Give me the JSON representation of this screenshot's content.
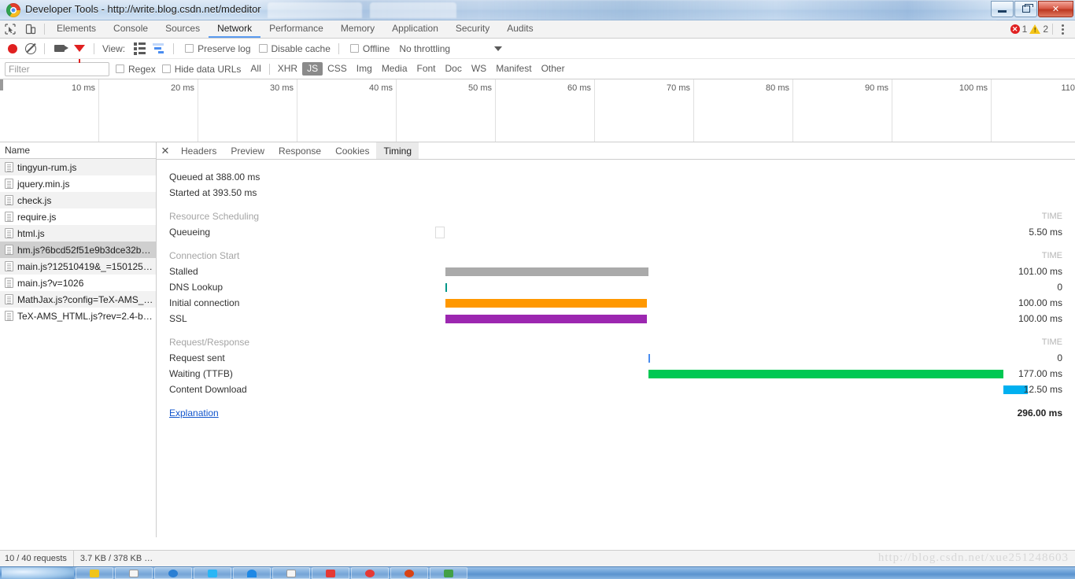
{
  "window": {
    "title": "Developer Tools - http://write.blog.csdn.net/mdeditor",
    "controls": {
      "minimize": "minimize",
      "maximize": "maximize",
      "close": "✕"
    }
  },
  "maintabs": {
    "inspect_icon": "inspect-element-icon",
    "device_icon": "device-toolbar-icon",
    "items": [
      {
        "label": "Elements",
        "active": false
      },
      {
        "label": "Console",
        "active": false
      },
      {
        "label": "Sources",
        "active": false
      },
      {
        "label": "Network",
        "active": true
      },
      {
        "label": "Performance",
        "active": false
      },
      {
        "label": "Memory",
        "active": false
      },
      {
        "label": "Application",
        "active": false
      },
      {
        "label": "Security",
        "active": false
      },
      {
        "label": "Audits",
        "active": false
      }
    ],
    "error_count": "1",
    "warning_count": "2",
    "menu_icon": "kebab-menu-icon"
  },
  "toolbar": {
    "record_icon": "record-icon",
    "clear_icon": "clear-icon",
    "camera_icon": "screenshot-camera-icon",
    "filter_icon": "filter-funnel-icon",
    "view_label": "View:",
    "view_list_icon": "list-view-icon",
    "view_waterfall_icon": "waterfall-view-icon",
    "preserve_log": "Preserve log",
    "disable_cache": "Disable cache",
    "offline": "Offline",
    "throttling": "No throttling"
  },
  "filterbar": {
    "filter_placeholder": "Filter",
    "filter_value": "",
    "regex": "Regex",
    "hide_data_urls": "Hide data URLs",
    "types": [
      {
        "label": "All",
        "active": false
      },
      {
        "label": "XHR",
        "active": false
      },
      {
        "label": "JS",
        "active": true
      },
      {
        "label": "CSS",
        "active": false
      },
      {
        "label": "Img",
        "active": false
      },
      {
        "label": "Media",
        "active": false
      },
      {
        "label": "Font",
        "active": false
      },
      {
        "label": "Doc",
        "active": false
      },
      {
        "label": "WS",
        "active": false
      },
      {
        "label": "Manifest",
        "active": false
      },
      {
        "label": "Other",
        "active": false
      }
    ]
  },
  "timeline_ruler": {
    "ticks": [
      "10 ms",
      "20 ms",
      "30 ms",
      "40 ms",
      "50 ms",
      "60 ms",
      "70 ms",
      "80 ms",
      "90 ms",
      "100 ms",
      "110"
    ]
  },
  "requests": {
    "header": "Name",
    "rows": [
      {
        "name": "tingyun-rum.js",
        "selected": false
      },
      {
        "name": "jquery.min.js",
        "selected": false
      },
      {
        "name": "check.js",
        "selected": false
      },
      {
        "name": "require.js",
        "selected": false
      },
      {
        "name": "html.js",
        "selected": false
      },
      {
        "name": "hm.js?6bcd52f51e9b3dce32be…",
        "selected": true
      },
      {
        "name": "main.js?12510419&_=1501250…",
        "selected": false
      },
      {
        "name": "main.js?v=1026",
        "selected": false
      },
      {
        "name": "MathJax.js?config=TeX-AMS_…",
        "selected": false
      },
      {
        "name": "TeX-AMS_HTML.js?rev=2.4-be…",
        "selected": false
      }
    ]
  },
  "detail": {
    "close_icon": "close-icon",
    "tabs": [
      {
        "label": "Headers",
        "active": false
      },
      {
        "label": "Preview",
        "active": false
      },
      {
        "label": "Response",
        "active": false
      },
      {
        "label": "Cookies",
        "active": false
      },
      {
        "label": "Timing",
        "active": true
      }
    ],
    "queued_at": "Queued at 388.00 ms",
    "started_at": "Started at 393.50 ms",
    "time_header": "TIME",
    "explanation_link": "Explanation",
    "total_time": "296.00 ms",
    "sections": [
      {
        "title": "Resource Scheduling",
        "rows": [
          {
            "label": "Queueing",
            "time": "5.50 ms",
            "bar": "queue",
            "left_pct": 0.0,
            "width_pct": 1.5
          }
        ]
      },
      {
        "title": "Connection Start",
        "rows": [
          {
            "label": "Stalled",
            "time": "101.00 ms",
            "bar": "stalled",
            "left_pct": 1.8,
            "width_pct": 34.1
          },
          {
            "label": "DNS Lookup",
            "time": "0",
            "bar": "dns",
            "left_pct": 1.8,
            "width_pct": 0.25
          },
          {
            "label": "Initial connection",
            "time": "100.00 ms",
            "bar": "conn",
            "left_pct": 1.8,
            "width_pct": 33.8
          },
          {
            "label": "SSL",
            "time": "100.00 ms",
            "bar": "ssl",
            "left_pct": 1.8,
            "width_pct": 33.8
          }
        ]
      },
      {
        "title": "Request/Response",
        "rows": [
          {
            "label": "Request sent",
            "time": "0",
            "bar": "reqsent",
            "left_pct": 35.9,
            "width_pct": 0.25
          },
          {
            "label": "Waiting (TTFB)",
            "time": "177.00 ms",
            "bar": "ttfb",
            "left_pct": 35.9,
            "width_pct": 59.8
          },
          {
            "label": "Content Download",
            "time": "12.50 ms",
            "bar": "dl",
            "left_pct": 95.7,
            "width_pct": 4.3
          }
        ]
      }
    ]
  },
  "statusbar": {
    "requests": "10 / 40 requests",
    "transferred": "3.7 KB / 378 KB …"
  },
  "watermark": "http://blog.csdn.net/xue251248603",
  "colors": {
    "stalled": "#aaaaaa",
    "dns": "#009688",
    "connection": "#ff9800",
    "ssl": "#9c27b0",
    "ttfb": "#00c853",
    "download": "#00b0f0",
    "accent": "#5a9bf0"
  }
}
